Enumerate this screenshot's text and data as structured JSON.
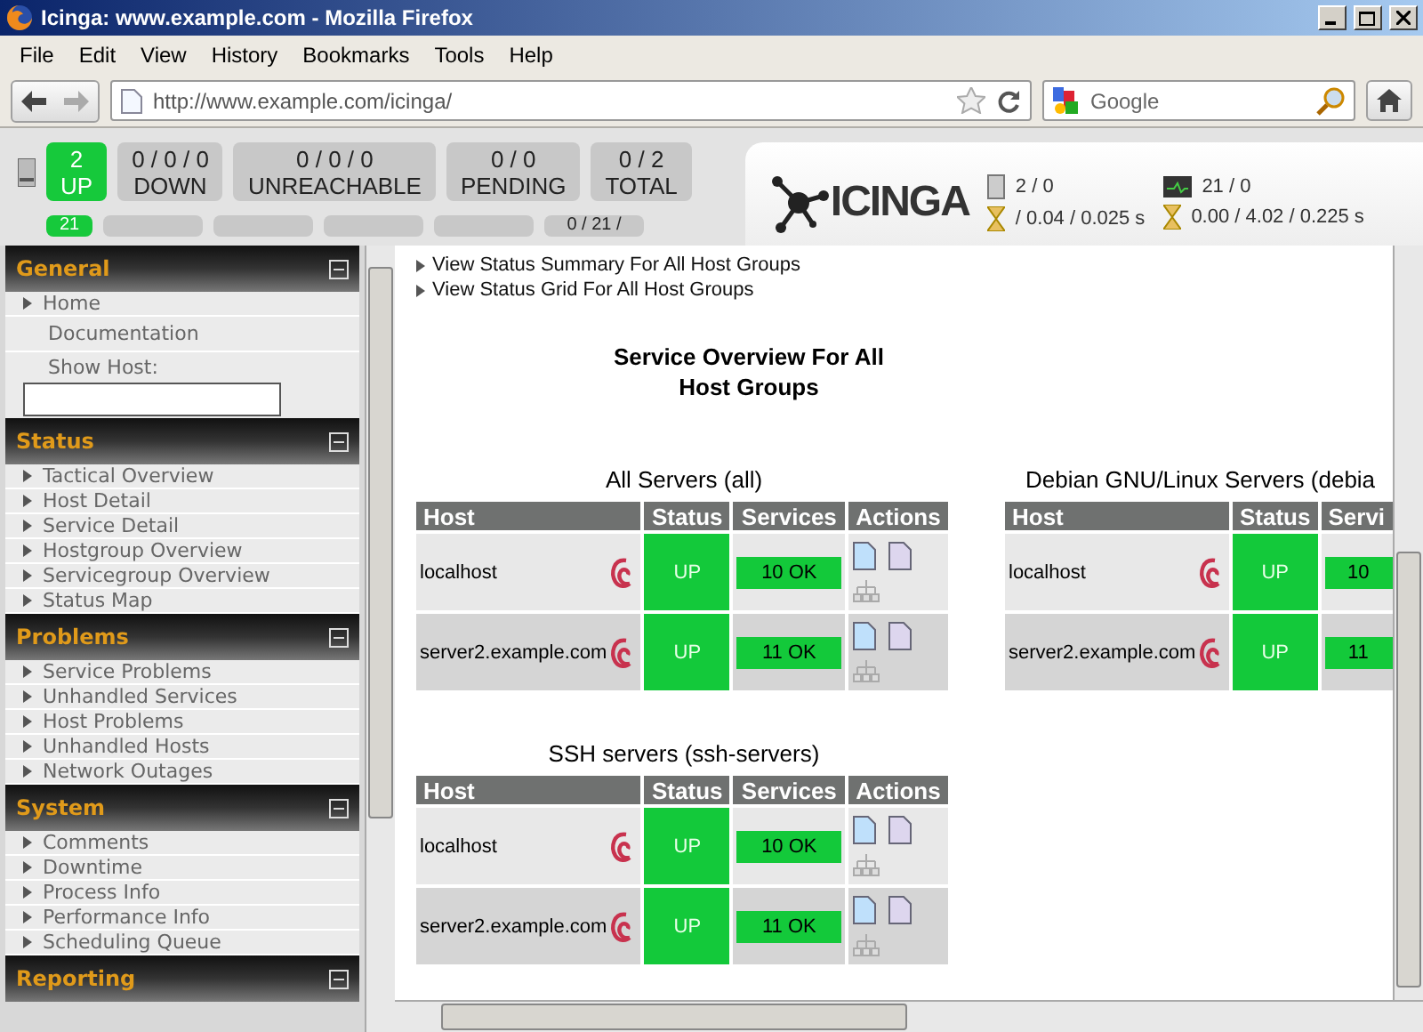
{
  "window": {
    "title": "Icinga: www.example.com - Mozilla Firefox"
  },
  "menu": [
    "File",
    "Edit",
    "View",
    "History",
    "Bookmarks",
    "Tools",
    "Help"
  ],
  "address": {
    "value": "http://www.example.com/icinga/"
  },
  "search": {
    "placeholder": "Google"
  },
  "host_totals": [
    {
      "value": "2",
      "label": "UP",
      "kind": "up"
    },
    {
      "value": "0 / 0 / 0",
      "label": "DOWN",
      "kind": "neutral"
    },
    {
      "value": "0 / 0 / 0",
      "label": "UNREACHABLE",
      "kind": "neutral"
    },
    {
      "value": "0 / 0",
      "label": "PENDING",
      "kind": "neutral"
    },
    {
      "value": "0 / 2",
      "label": "TOTAL",
      "kind": "neutral"
    }
  ],
  "service_totals": [
    {
      "kind": "up",
      "value": "21"
    },
    {
      "kind": "neutral"
    },
    {
      "kind": "neutral"
    },
    {
      "kind": "neutral"
    },
    {
      "kind": "neutral"
    },
    {
      "kind": "neutral",
      "value": "0 / 21 /"
    }
  ],
  "logo": "ICINGA",
  "performance": {
    "hosts": "2 / 0",
    "host_latency": "/ 0.04 / 0.025 s",
    "services": "21 / 0",
    "service_latency": "0.00 / 4.02 / 0.225 s"
  },
  "sidebar": [
    {
      "title": "General",
      "items": [
        {
          "label": "Home",
          "kind": "link"
        },
        {
          "label": "Documentation",
          "kind": "plain"
        },
        {
          "label": "Show Host:",
          "kind": "field"
        }
      ]
    },
    {
      "title": "Status",
      "items": [
        {
          "label": "Tactical Overview",
          "kind": "link"
        },
        {
          "label": "Host Detail",
          "kind": "link"
        },
        {
          "label": "Service Detail",
          "kind": "link"
        },
        {
          "label": "Hostgroup Overview",
          "kind": "link"
        },
        {
          "label": "Servicegroup Overview",
          "kind": "link"
        },
        {
          "label": "Status Map",
          "kind": "link"
        }
      ]
    },
    {
      "title": "Problems",
      "items": [
        {
          "label": "Service Problems",
          "kind": "link"
        },
        {
          "label": "Unhandled Services",
          "kind": "link"
        },
        {
          "label": "Host Problems",
          "kind": "link"
        },
        {
          "label": "Unhandled Hosts",
          "kind": "link"
        },
        {
          "label": "Network Outages",
          "kind": "link"
        }
      ]
    },
    {
      "title": "System",
      "items": [
        {
          "label": "Comments",
          "kind": "link"
        },
        {
          "label": "Downtime",
          "kind": "link"
        },
        {
          "label": "Process Info",
          "kind": "link"
        },
        {
          "label": "Performance Info",
          "kind": "link"
        },
        {
          "label": "Scheduling Queue",
          "kind": "link"
        }
      ]
    },
    {
      "title": "Reporting"
    }
  ],
  "links": [
    "View Status Summary For All Host Groups",
    "View Status Grid For All Host Groups"
  ],
  "heading": [
    "Service Overview For All",
    "Host Groups"
  ],
  "groups": [
    {
      "title": "All Servers (all)",
      "columns": [
        "Host",
        "Status",
        "Services",
        "Actions"
      ],
      "rows": [
        {
          "host": "localhost",
          "status": "UP",
          "services": "10 OK"
        },
        {
          "host": "server2.example.com",
          "status": "UP",
          "services": "11 OK"
        }
      ]
    },
    {
      "title": "Debian GNU/Linux Servers (debia",
      "columns": [
        "Host",
        "Status",
        "Servi"
      ],
      "rows": [
        {
          "host": "localhost",
          "status": "UP",
          "services": "10"
        },
        {
          "host": "server2.example.com",
          "status": "UP",
          "services": "11"
        }
      ]
    },
    {
      "title": "SSH servers (ssh-servers)",
      "columns": [
        "Host",
        "Status",
        "Services",
        "Actions"
      ],
      "rows": [
        {
          "host": "localhost",
          "status": "UP",
          "services": "10 OK"
        },
        {
          "host": "server2.example.com",
          "status": "UP",
          "services": "11 OK"
        }
      ]
    }
  ]
}
